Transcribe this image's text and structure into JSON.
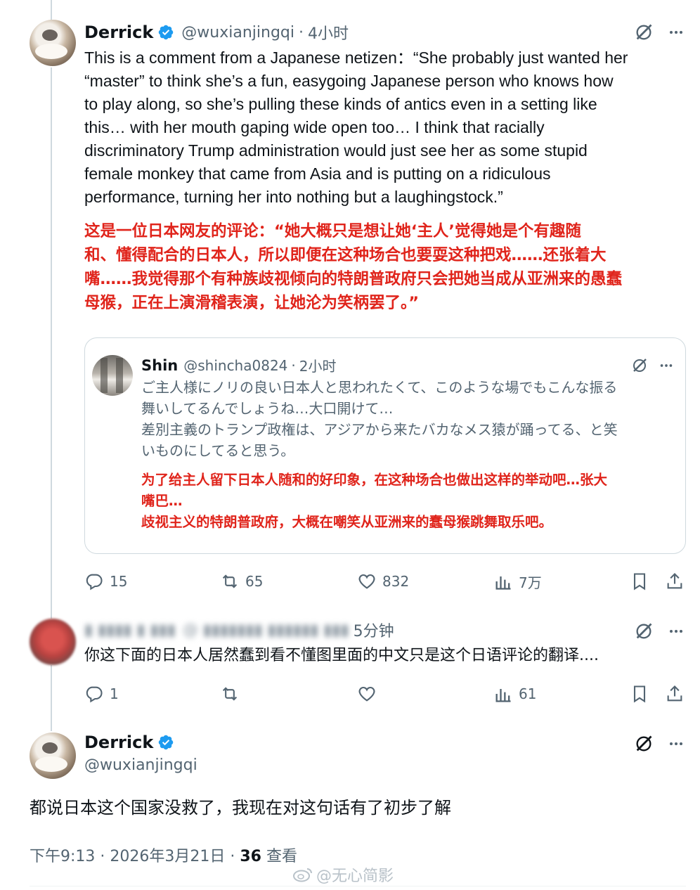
{
  "colors": {
    "accent_blue": "#1d9bf0",
    "red_text": "#e0241b",
    "secondary_text": "#536471"
  },
  "tweet1": {
    "name": "Derrick",
    "handle": "@wuxianjingqi",
    "sep": "·",
    "time": "4小时",
    "english_lines": [
      "This is a comment from a Japanese netizen：“She probably just wanted her",
      "“master” to think she’s a fun, easygoing Japanese person who knows how",
      "to play along, so she’s pulling these kinds of antics even in a setting like",
      "this… with her mouth gaping wide open too… I think that racially",
      "discriminatory Trump administration would just see her as some stupid",
      "female monkey that came from Asia and is putting on a ridiculous",
      "performance, turning her into nothing but a laughingstock.”"
    ],
    "chinese_lines": [
      "这是一位日本网友的评论：“她大概只是想让她‘主人’觉得她是个有趣随",
      "和、懂得配合的日本人，所以即便在这种场合也要耍这种把戏……还张着大",
      "嘴……我觉得那个有种族歧视倾向的特朗普政府只会把她当成从亚洲来的愚蠢",
      "母猴，正在上演滑稽表演，让她沦为笑柄罢了。”"
    ],
    "quote": {
      "name": "Shin",
      "handle": "@shincha0824",
      "sep": "·",
      "time": "2小时",
      "japanese_lines": [
        "ご主人様にノリの良い日本人と思われたくて、このような場でもこんな振る",
        "舞いしてるんでしょうね…大口開けて…",
        "差別主義のトランプ政権は、アジアから来たバカなメス猿が踊ってる、と笑",
        "いものにしてると思う。"
      ],
      "chinese_lines": [
        "为了给主人留下日本人随和的好印象，在这种场合也做出这样的举动吧…张大",
        "嘴巴…",
        "歧视主义的特朗普政府，大概在嘲笑从亚洲来的蠢母猴跳舞取乐吧。"
      ]
    },
    "stats": {
      "replies": "15",
      "retweets": "65",
      "likes": "832",
      "views": "7万"
    }
  },
  "tweet2": {
    "name_blurred": "▮ ▮▮▮▮ ▮ ▮▮▮",
    "handle_blurred": "@ ▮▮▮▮▮▮▮ ▮▮▮▮▮▮ ▮▮▮",
    "time": "5分钟",
    "text": "你这下面的日本人居然蠢到看不懂图里面的中文只是这个日语评论的翻译....",
    "stats": {
      "replies": "1",
      "retweets": "",
      "likes": "",
      "views": "61"
    }
  },
  "tweet3": {
    "name": "Derrick",
    "handle": "@wuxianjingqi",
    "text": "都说日本这个国家没救了，我现在对这句话有了初步了解",
    "timestamp": "下午9:13 · 2026年3月21日 · ",
    "views_count": "36",
    "views_label": " 查看"
  },
  "watermark": "@无心简影"
}
